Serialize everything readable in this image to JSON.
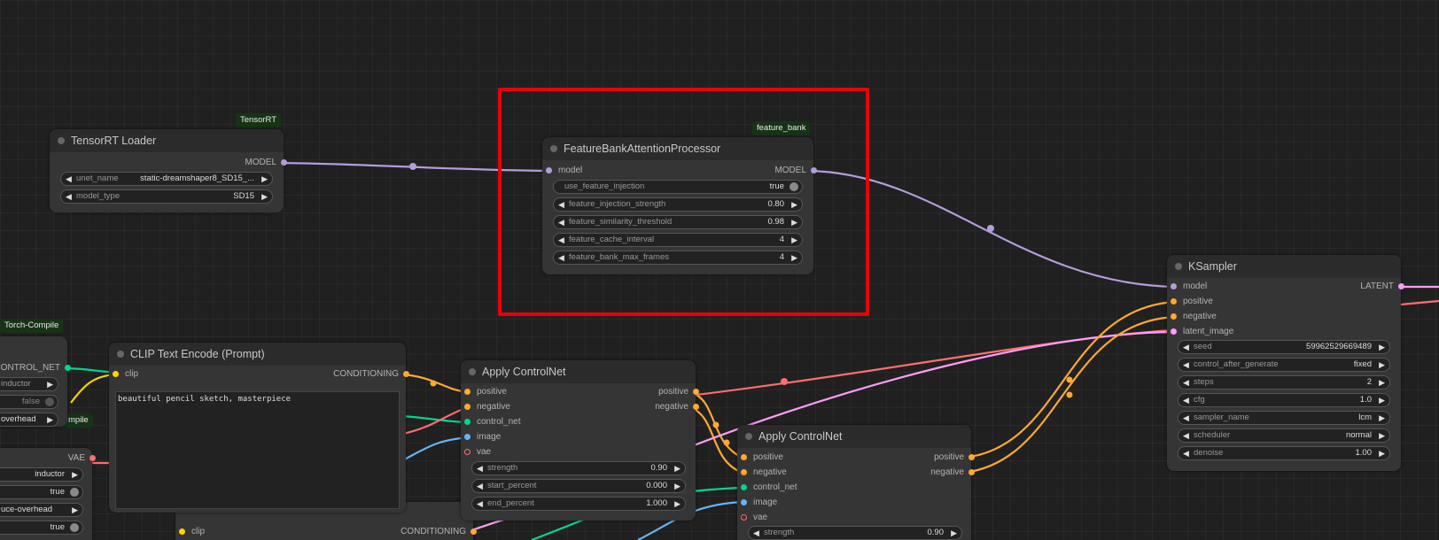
{
  "colors": {
    "model": "#b39ddb",
    "conditioning": "#ffa931",
    "control_net": "#00d78d",
    "image": "#64b5f6",
    "vae": "#ff6e6e",
    "latent": "#ff9cf9",
    "clip": "#ffd500",
    "highlight": "#e8000b"
  },
  "badges": {
    "tensorrt": "TensorRT",
    "feature_bank": "feature_bank",
    "torch_compile": "Torch-Compile",
    "compile_partial": "mpile"
  },
  "tensorrt_loader": {
    "title": "TensorRT Loader",
    "out_model": "MODEL",
    "unet_name_label": "unet_name",
    "unet_name_value": "static-dreamshaper8_SD15_...",
    "model_type_label": "model_type",
    "model_type_value": "SD15"
  },
  "feature_bank": {
    "title": "FeatureBankAttentionProcessor",
    "in_model": "model",
    "out_model": "MODEL",
    "use_label": "use_feature_injection",
    "use_value": "true",
    "widgets": [
      {
        "label": "feature_injection_strength",
        "value": "0.80"
      },
      {
        "label": "feature_similarity_threshold",
        "value": "0.98"
      },
      {
        "label": "feature_cache_interval",
        "value": "4"
      },
      {
        "label": "feature_bank_max_frames",
        "value": "4"
      }
    ]
  },
  "ksampler": {
    "title": "KSampler",
    "in_model": "model",
    "in_positive": "positive",
    "in_negative": "negative",
    "in_latent": "latent_image",
    "out_latent": "LATENT",
    "widgets": [
      {
        "label": "seed",
        "value": "59962529669489"
      },
      {
        "label": "control_after_generate",
        "value": "fixed"
      },
      {
        "label": "steps",
        "value": "2"
      },
      {
        "label": "cfg",
        "value": "1.0"
      },
      {
        "label": "sampler_name",
        "value": "lcm"
      },
      {
        "label": "scheduler",
        "value": "normal"
      },
      {
        "label": "denoise",
        "value": "1.00"
      }
    ]
  },
  "clip_encode": {
    "title": "CLIP Text Encode (Prompt)",
    "in_clip": "clip",
    "out_conditioning": "CONDITIONING",
    "text": "beautiful pencil sketch, masterpiece"
  },
  "clip_encode2": {
    "in_clip": "clip",
    "out_conditioning": "CONDITIONING"
  },
  "apply_cn1": {
    "title": "Apply ControlNet",
    "in_positive": "positive",
    "in_negative": "negative",
    "in_control_net": "control_net",
    "in_image": "image",
    "in_vae": "vae",
    "out_positive": "positive",
    "out_negative": "negative",
    "strength_label": "strength",
    "strength_value": "0.90",
    "start_label": "start_percent",
    "start_value": "0.000",
    "end_label": "end_percent",
    "end_value": "1.000"
  },
  "apply_cn2": {
    "title": "Apply ControlNet",
    "in_positive": "positive",
    "in_negative": "negative",
    "in_control_net": "control_net",
    "in_image": "image",
    "in_vae": "vae",
    "out_positive": "positive",
    "out_negative": "negative",
    "strength_label": "strength",
    "strength_value": "0.90"
  },
  "left_partial": {
    "out_control_net": "CONTROL_NET",
    "w1_value": "inductor",
    "w2_value": "false",
    "w3_value": "overhead"
  },
  "left_partial2": {
    "out_vae": "VAE",
    "w1_value": "inductor",
    "w2_value": "true",
    "w3_value": "uce-overhead",
    "w4_value": "true"
  }
}
